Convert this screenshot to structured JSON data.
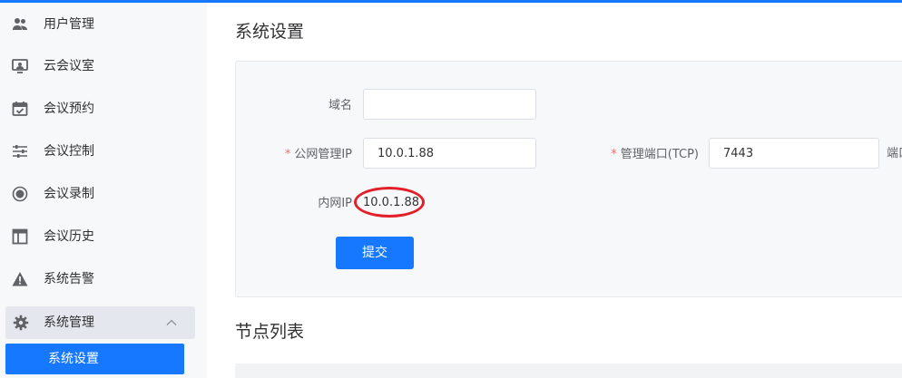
{
  "sidebar": {
    "items": [
      {
        "label": "用户管理",
        "icon": "users-icon"
      },
      {
        "label": "云会议室",
        "icon": "meeting-room-icon"
      },
      {
        "label": "会议预约",
        "icon": "calendar-check-icon"
      },
      {
        "label": "会议控制",
        "icon": "sliders-icon"
      },
      {
        "label": "会议录制",
        "icon": "record-icon"
      },
      {
        "label": "会议历史",
        "icon": "layout-icon"
      },
      {
        "label": "系统告警",
        "icon": "warning-icon"
      }
    ],
    "expanded_item": {
      "label": "系统管理",
      "icon": "gear-icon"
    },
    "sub_item": {
      "label": "系统设置"
    }
  },
  "main": {
    "title": "系统设置",
    "form": {
      "domain_label": "域名",
      "domain_value": "",
      "public_ip_label": "公网管理IP",
      "public_ip_value": "10.0.1.88",
      "port_label": "管理端口(TCP)",
      "port_value": "7443",
      "port_suffix": "端口",
      "internal_ip_label": "内网IP",
      "internal_ip_value": "10.0.1.88",
      "required_mark": "*",
      "submit_label": "提交"
    },
    "node_list_title": "节点列表"
  },
  "colors": {
    "accent": "#1677ff",
    "annotation": "#e3202a"
  }
}
